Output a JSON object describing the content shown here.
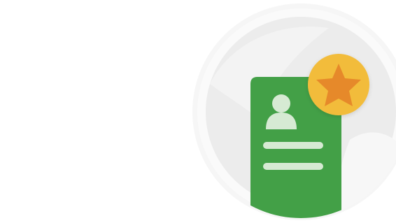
{
  "illustration": {
    "subject": "profile-card-with-star-badge",
    "icons": [
      "profile-card-icon",
      "avatar-icon",
      "star-badge-icon"
    ]
  },
  "colors": {
    "background": "#ffffff",
    "circle_outer": "#f4f4f4",
    "circle_inner": "#ebebeb",
    "circle_ring": "#fafafa",
    "card_green": "#43a047",
    "card_detail": "#d6ead3",
    "badge_yellow": "#f2bc3a",
    "star_orange": "#e6892a"
  }
}
